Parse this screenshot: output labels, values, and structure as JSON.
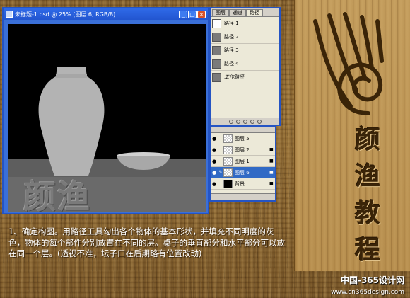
{
  "document": {
    "title": "未标题-1.psd @ 25% (图层 6, RGB/8)",
    "watermark": "颜渔"
  },
  "paths_panel": {
    "tabs": [
      "图层",
      "通道",
      "路径"
    ],
    "paths": [
      {
        "label": "路径 1"
      },
      {
        "label": "路径 2"
      },
      {
        "label": "路径 3"
      },
      {
        "label": "路径 4"
      },
      {
        "label": "工作路径"
      }
    ]
  },
  "layers_panel": {
    "layers": [
      {
        "label": "图层 5",
        "thumb": "checker"
      },
      {
        "label": "图层 2",
        "thumb": "checker"
      },
      {
        "label": "图层 1",
        "thumb": "checker"
      },
      {
        "label": "图层 6",
        "thumb": "checker",
        "selected": true
      },
      {
        "label": "背景",
        "thumb": "black"
      }
    ]
  },
  "brand": {
    "chars": [
      "颜",
      "渔",
      "教",
      "程"
    ],
    "site_name": "中国-365设计网",
    "site_url": "www.cn365design.com"
  },
  "caption": "1、确定构图。用路径工具勾出各个物体的基本形状，并填充不同明度的灰色，物体的每个部件分别放置在不同的层。桌子的垂直部分和水平部分可以放在同一个层。(透视不准，坛子口在后期略有位置改动)"
}
